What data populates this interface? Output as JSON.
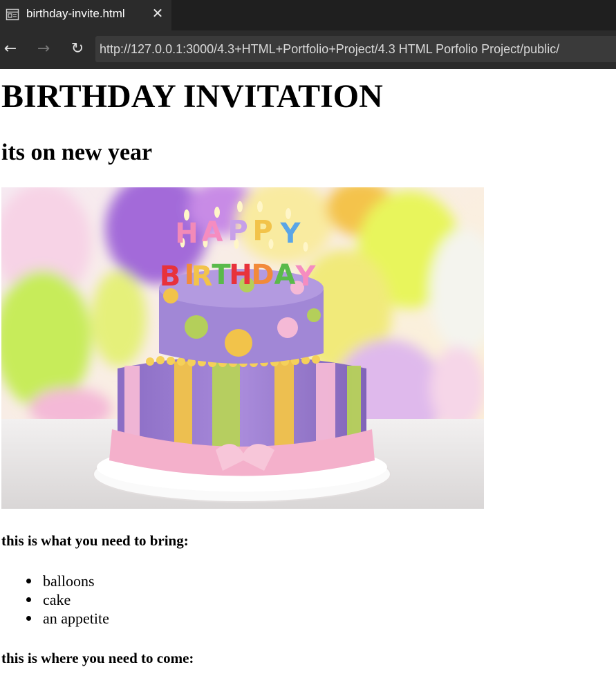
{
  "browser": {
    "tab": {
      "title": "birthday-invite.html",
      "icon": "page-preview-icon",
      "close_icon": "close-icon",
      "close_glyph": "✕"
    },
    "nav": {
      "back_icon": "back-arrow-icon",
      "forward_icon": "forward-arrow-icon",
      "reload_icon": "reload-icon"
    },
    "url": "http://127.0.0.1:3000/4.3+HTML+Portfolio+Project/4.3 HTML Porfolio Project/public/"
  },
  "page": {
    "title": "BIRTHDAY INVITATION",
    "subtitle": "its on new year",
    "image": {
      "cake_letters_top": "HAPPY",
      "cake_letters_bottom": "BIRTHDAY"
    },
    "bring_heading": "this is what you need to bring:",
    "bring_items": [
      "balloons",
      "cake",
      "an appetite"
    ],
    "where_heading": "this is where you need to come:"
  },
  "colors": {
    "tabbar_bg": "#1f1f1f",
    "toolbar_bg": "#2b2b2b",
    "url_bg": "#3a3a3a",
    "text": "#000000"
  }
}
